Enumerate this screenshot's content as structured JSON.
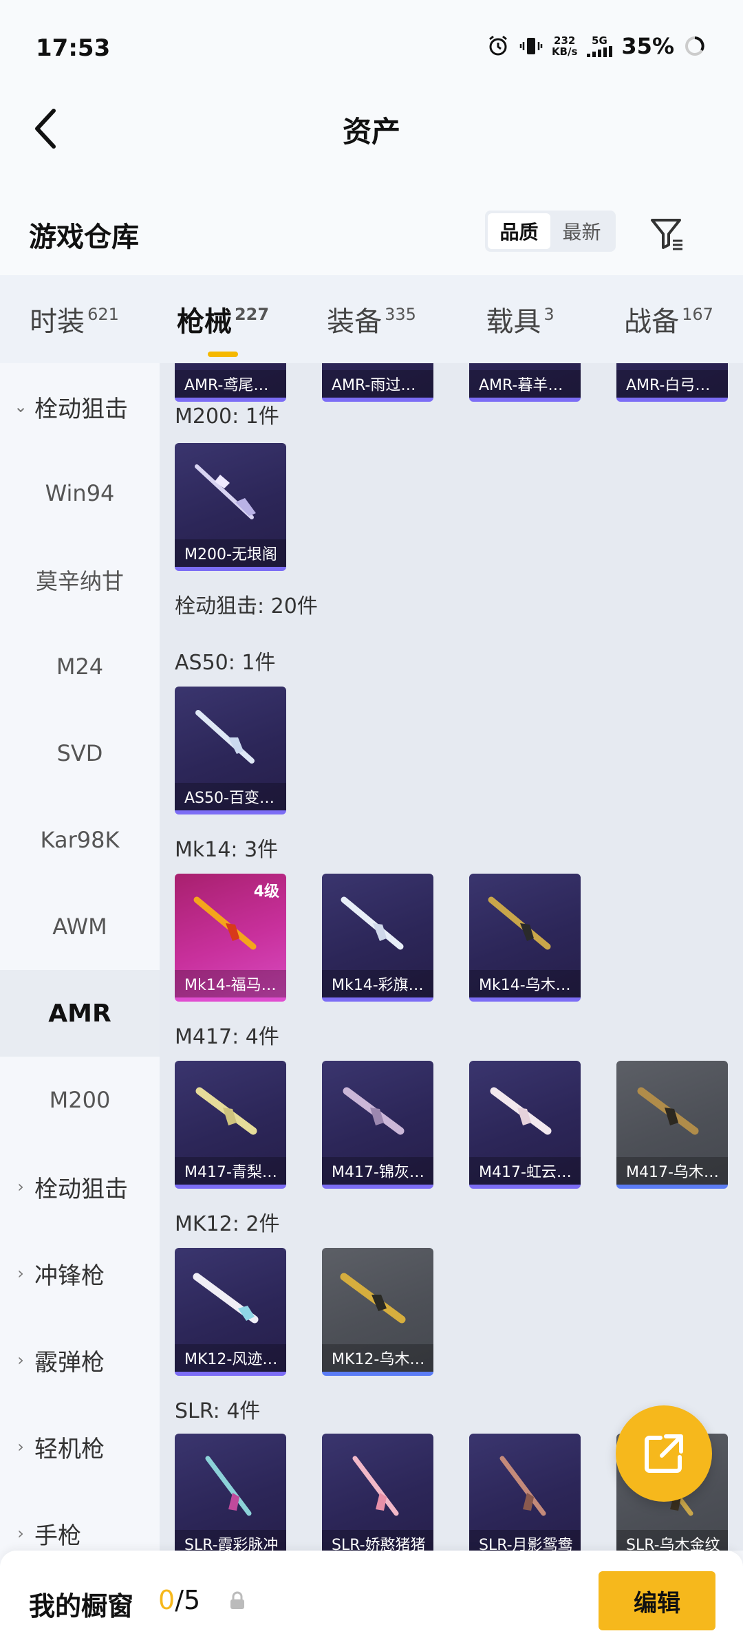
{
  "status": {
    "time": "17:53",
    "net_speed_value": "232",
    "net_speed_unit": "KB/s",
    "signal": "5G",
    "battery": "35%"
  },
  "header": {
    "title": "资产"
  },
  "warehouse": {
    "title": "游戏仓库",
    "sort_options": [
      "品质",
      "最新"
    ],
    "active_sort": "品质"
  },
  "tabs": [
    {
      "label": "时装",
      "count": "621"
    },
    {
      "label": "枪械",
      "count": "227",
      "active": true
    },
    {
      "label": "装备",
      "count": "335"
    },
    {
      "label": "载具",
      "count": "3"
    },
    {
      "label": "战备",
      "count": "167"
    }
  ],
  "sidenav": [
    {
      "label": "栓动狙击",
      "type": "group",
      "expanded": true
    },
    {
      "label": "Win94"
    },
    {
      "label": "莫辛纳甘"
    },
    {
      "label": "M24"
    },
    {
      "label": "SVD"
    },
    {
      "label": "Kar98K"
    },
    {
      "label": "AWM"
    },
    {
      "label": "AMR",
      "selected": true
    },
    {
      "label": "M200"
    },
    {
      "label": "栓动狙击",
      "type": "group"
    },
    {
      "label": "冲锋枪",
      "type": "group"
    },
    {
      "label": "霰弹枪",
      "type": "group"
    },
    {
      "label": "轻机枪",
      "type": "group"
    },
    {
      "label": "手枪",
      "type": "group"
    }
  ],
  "content": {
    "top_row": [
      "AMR-鸢尾…",
      "AMR-雨过…",
      "AMR-暮羊…",
      "AMR-白弓…"
    ],
    "sections": [
      {
        "title": "M200: 1件",
        "items": [
          {
            "label": "M200-无垠阁",
            "style": "purple"
          }
        ]
      },
      {
        "title": "栓动狙击: 20件",
        "items": []
      },
      {
        "title": "AS50: 1件",
        "items": [
          {
            "label": "AS50-百变…",
            "style": "purple"
          }
        ]
      },
      {
        "title": "Mk14: 3件",
        "items": [
          {
            "label": "Mk14-福马…",
            "style": "pink",
            "level": "4级"
          },
          {
            "label": "Mk14-彩旗…",
            "style": "purple"
          },
          {
            "label": "Mk14-乌木…",
            "style": "purple"
          }
        ]
      },
      {
        "title": "M417: 4件",
        "items": [
          {
            "label": "M417-青梨…",
            "style": "purple"
          },
          {
            "label": "M417-锦灰…",
            "style": "purple"
          },
          {
            "label": "M417-虹云…",
            "style": "purple"
          },
          {
            "label": "M417-乌木…",
            "style": "grey"
          }
        ]
      },
      {
        "title": "MK12: 2件",
        "items": [
          {
            "label": "MK12-风迹…",
            "style": "purple"
          },
          {
            "label": "MK12-乌木…",
            "style": "grey"
          }
        ]
      },
      {
        "title": "SLR: 4件",
        "items": [
          {
            "label": "SLR-霞彩脉冲",
            "style": "purple"
          },
          {
            "label": "SLR-娇憨猪猪",
            "style": "purple"
          },
          {
            "label": "SLR-月影鸳鸯",
            "style": "purple"
          },
          {
            "label": "SLR-乌木金纹",
            "style": "grey"
          }
        ]
      }
    ]
  },
  "bottom": {
    "title": "我的橱窗",
    "count_current": "0",
    "count_total": "/5",
    "edit_label": "编辑"
  }
}
